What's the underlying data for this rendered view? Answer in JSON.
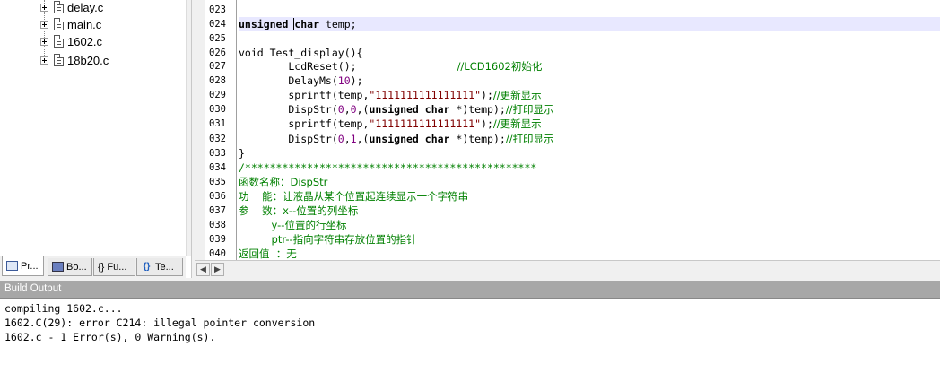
{
  "project_tree": {
    "files": [
      "delay.c",
      "main.c",
      "1602.c",
      "18b20.c"
    ]
  },
  "project_tabs": [
    {
      "label": "Pr...",
      "icon": "project-icon"
    },
    {
      "label": "Bo...",
      "icon": "books-icon"
    },
    {
      "label": "{} Fu...",
      "icon": "functions-icon"
    },
    {
      "label": "Te...",
      "icon": "templates-icon"
    }
  ],
  "editor": {
    "line_numbers": [
      "023",
      "024",
      "025",
      "026",
      "027",
      "028",
      "029",
      "030",
      "031",
      "032",
      "033",
      "034",
      "035",
      "036",
      "037",
      "038",
      "039",
      "040"
    ],
    "current_line": "024",
    "lines": {
      "l23": "",
      "l24": {
        "kw1": "unsigned",
        "kw2": "char",
        "rest": " temp;"
      },
      "l25": "",
      "l26": "void Test_display(){",
      "l27": {
        "code": "        LcdReset();",
        "comment": "//LCD1602初始化"
      },
      "l28": {
        "code": "        DelayMs(",
        "num": "10",
        "tail": ");"
      },
      "l29": {
        "code": "        sprintf(temp,",
        "str": "\"1111111111111111\"",
        "tail": ");",
        "comment": "//更新显示"
      },
      "l30": {
        "code": "        DispStr(",
        "n1": "0",
        "c1": ",",
        "n2": "0",
        "c2": ",(",
        "kw1": "unsigned",
        "kw2": "char",
        "tail": " *)temp);",
        "comment": "//打印显示"
      },
      "l31": {
        "code": "        sprintf(temp,",
        "str": "\"1111111111111111\"",
        "tail": ");",
        "comment": "//更新显示"
      },
      "l32": {
        "code": "        DispStr(",
        "n1": "0",
        "c1": ",",
        "n2": "1",
        "c2": ",(",
        "kw1": "unsigned",
        "kw2": "char",
        "tail": " *)temp);",
        "comment": "//打印显示"
      },
      "l33": "}",
      "l34": "/***********************************************",
      "l35": "函数名称：DispStr",
      "l36": "功    能：让液晶从某个位置起连续显示一个字符串",
      "l37": "参    数：x--位置的列坐标",
      "l38": "          y--位置的行坐标",
      "l39": "          ptr--指向字符串存放位置的指针",
      "l40": "返回值  ：无"
    }
  },
  "build_output": {
    "title": "Build Output",
    "lines": [
      "compiling 1602.c...",
      "1602.C(29): error C214: illegal pointer conversion",
      "1602.c - 1 Error(s), 0 Warning(s)."
    ]
  },
  "colors": {
    "keyword": "#000000",
    "number": "#800080",
    "string": "#800000",
    "comment": "#008000",
    "current_line": "#e8e8ff",
    "build_title_bg": "#a7a7a7"
  }
}
